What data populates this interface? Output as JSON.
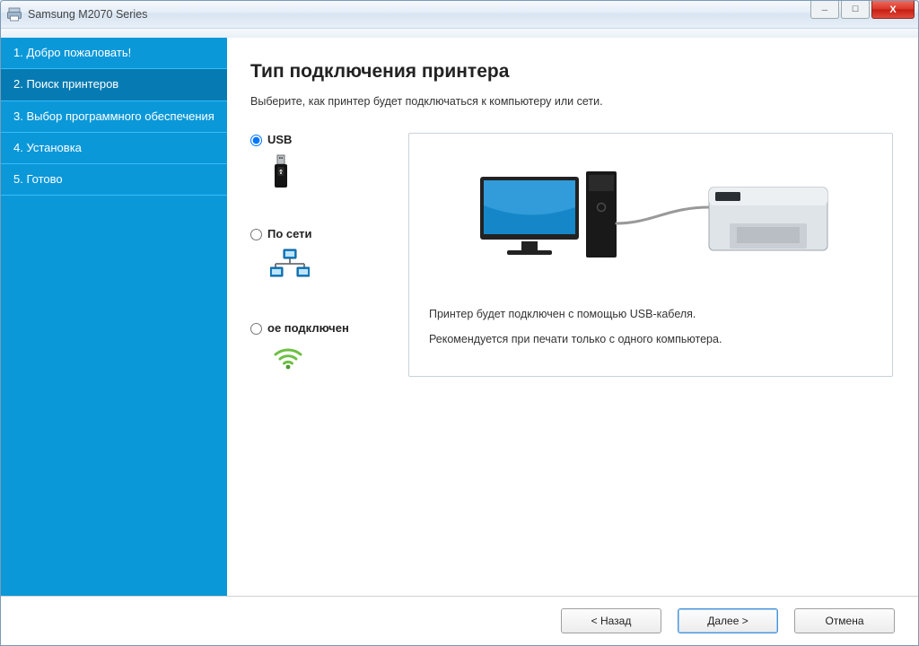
{
  "window": {
    "title": "Samsung M2070 Series"
  },
  "sidebar": {
    "items": [
      {
        "label": "1. Добро пожаловать!"
      },
      {
        "label": "2. Поиск принтеров"
      },
      {
        "label": "3. Выбор программного обеспечения"
      },
      {
        "label": "4. Установка"
      },
      {
        "label": "5. Готово"
      }
    ],
    "active_index": 1
  },
  "main": {
    "heading": "Тип подключения принтера",
    "subtitle": "Выберите, как принтер будет подключаться к компьютеру или сети."
  },
  "options": {
    "selected": "usb",
    "usb": {
      "label": "USB"
    },
    "network": {
      "label": "По сети"
    },
    "wireless": {
      "label": "ое подключен"
    }
  },
  "preview": {
    "line1": "Принтер будет подключен с помощью USB-кабеля.",
    "line2": "Рекомендуется при печати только с одного компьютера."
  },
  "buttons": {
    "back": "< Назад",
    "next": "Далее >",
    "cancel": "Отмена"
  }
}
